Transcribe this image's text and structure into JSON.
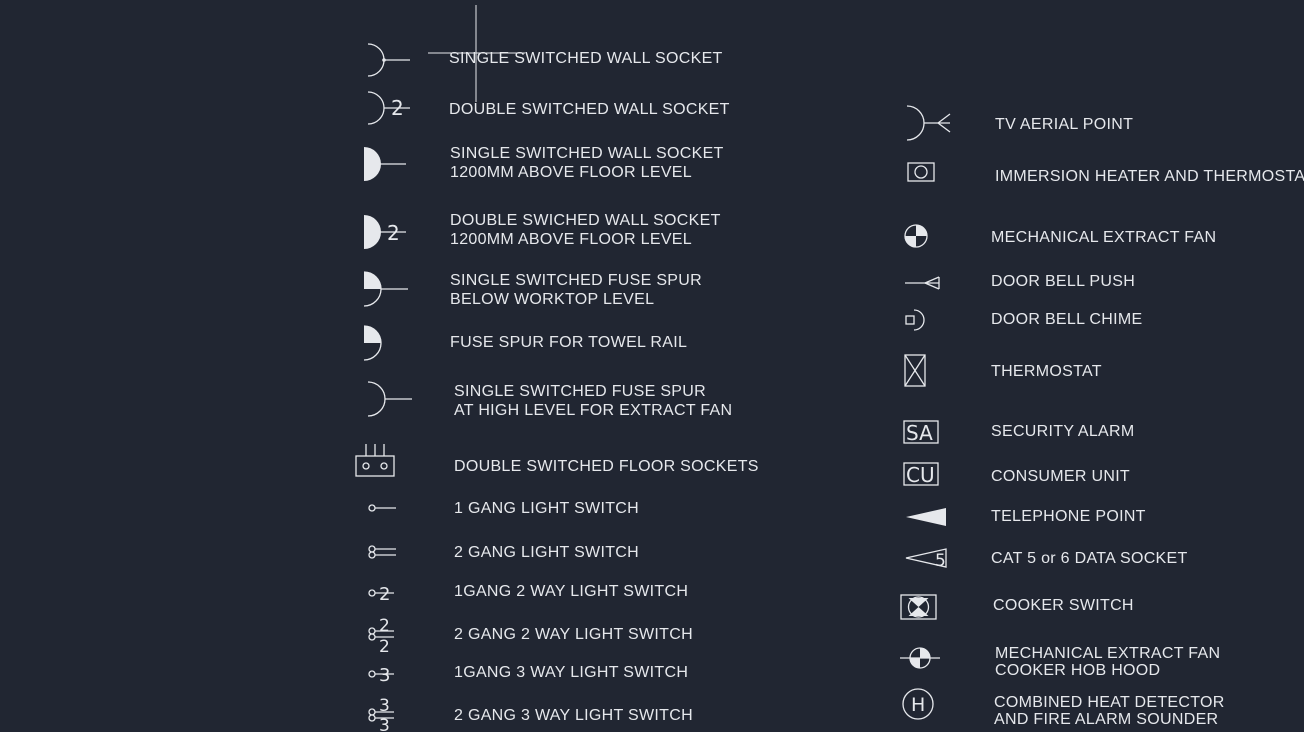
{
  "colors": {
    "background": "#212632",
    "foreground": "#e6e8ec"
  },
  "legend": {
    "left": [
      {
        "icon": "single-switched-socket-icon",
        "lines": [
          "SINGLE SWITCHED WALL SOCKET"
        ]
      },
      {
        "icon": "double-switched-socket-icon",
        "lines": [
          "DOUBLE SWITCHED WALL SOCKET"
        ]
      },
      {
        "icon": "high-single-socket-icon",
        "lines": [
          "SINGLE SWITCHED WALL SOCKET",
          "1200MM ABOVE FLOOR LEVEL"
        ]
      },
      {
        "icon": "high-double-socket-icon",
        "lines": [
          "DOUBLE SWICHED WALL SOCKET",
          "1200MM ABOVE FLOOR LEVEL"
        ]
      },
      {
        "icon": "fuse-spur-worktop-icon",
        "lines": [
          "SINGLE SWITCHED FUSE SPUR",
          "BELOW WORKTOP LEVEL"
        ]
      },
      {
        "icon": "fuse-spur-towel-icon",
        "lines": [
          "FUSE SPUR FOR TOWEL RAIL"
        ]
      },
      {
        "icon": "fuse-spur-extract-icon",
        "lines": [
          "SINGLE SWITCHED FUSE SPUR",
          "AT HIGH LEVEL FOR EXTRACT FAN"
        ]
      },
      {
        "icon": "floor-sockets-icon",
        "lines": [
          "DOUBLE SWITCHED FLOOR SOCKETS"
        ]
      },
      {
        "icon": "light-switch-1-gang-icon",
        "lines": [
          "1 GANG LIGHT SWITCH"
        ]
      },
      {
        "icon": "light-switch-2-gang-icon",
        "lines": [
          "2 GANG LIGHT SWITCH"
        ]
      },
      {
        "icon": "light-switch-1-gang-2-way-icon",
        "lines": [
          "1GANG 2 WAY LIGHT SWITCH"
        ]
      },
      {
        "icon": "light-switch-2-gang-2-way-icon",
        "lines": [
          "2 GANG 2 WAY LIGHT SWITCH"
        ]
      },
      {
        "icon": "light-switch-1-gang-3-way-icon",
        "lines": [
          "1GANG 3 WAY LIGHT SWITCH"
        ]
      },
      {
        "icon": "light-switch-2-gang-3-way-icon",
        "lines": [
          "2 GANG 3 WAY LIGHT SWITCH"
        ]
      }
    ],
    "right": [
      {
        "icon": "tv-aerial-icon",
        "lines": [
          "TV AERIAL POINT"
        ]
      },
      {
        "icon": "immersion-heater-icon",
        "lines": [
          "IMMERSION HEATER AND THERMOSTAT"
        ]
      },
      {
        "icon": "extract-fan-icon",
        "lines": [
          "MECHANICAL EXTRACT FAN"
        ]
      },
      {
        "icon": "door-bell-push-icon",
        "lines": [
          "DOOR BELL PUSH"
        ]
      },
      {
        "icon": "door-bell-chime-icon",
        "lines": [
          "DOOR BELL CHIME"
        ]
      },
      {
        "icon": "thermostat-icon",
        "lines": [
          "THERMOSTAT"
        ]
      },
      {
        "icon": "security-alarm-icon",
        "lines": [
          "SECURITY ALARM"
        ]
      },
      {
        "icon": "consumer-unit-icon",
        "lines": [
          "CONSUMER UNIT"
        ]
      },
      {
        "icon": "telephone-point-icon",
        "lines": [
          "TELEPHONE POINT"
        ]
      },
      {
        "icon": "data-socket-icon",
        "lines": [
          "CAT 5 or 6 DATA SOCKET"
        ]
      },
      {
        "icon": "cooker-switch-icon",
        "lines": [
          "COOKER SWITCH"
        ]
      },
      {
        "icon": "hob-hood-fan-icon",
        "lines": [
          "MECHANICAL EXTRACT FAN",
          "COOKER HOB HOOD"
        ]
      },
      {
        "icon": "heat-detector-icon",
        "lines": [
          "COMBINED HEAT DETECTOR",
          "AND FIRE ALARM SOUNDER"
        ]
      }
    ]
  },
  "symbol_text": {
    "two": "2",
    "three": "3",
    "five": "5",
    "security": "SA",
    "consumer": "CU",
    "heat": "H"
  }
}
